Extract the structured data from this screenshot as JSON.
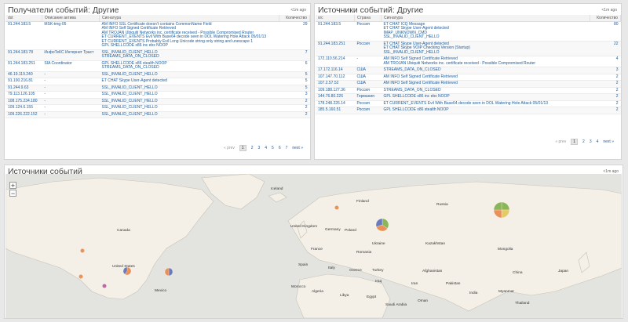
{
  "receivers": {
    "title": "Получатели событий: Другие",
    "ago": "<1m ago",
    "columns": [
      "dst",
      "Описание актива",
      "Сигнатура",
      "Количество"
    ],
    "rows": [
      {
        "dst": "91.244.183.5",
        "asset": "MSK-tmg-05",
        "signatures": [
          "AM INFO SSL Certificate doesn't contains CommonName Field",
          "AM INFO Self Signed Certificate Retrieved",
          "AM TROJAN Ubiquiti Networks inc. certificate received - Possible Compromised Router",
          "ET CURRENT_EVENTS Evil With Base64 decode seen in DOL Watering Hole Attack 05/01/13",
          "ET CURRENT_EVENTS Probably Evil Long Unicode string only string and unescape 1",
          "GPL SHELLCODE x86 inc ebx NOOP"
        ],
        "count": "29"
      },
      {
        "dst": "91.244.183.78",
        "asset": "ИнфоТеКС Интернет Траст",
        "signatures": [
          "SSL_INVALID_CLIENT_HELLO",
          "STREAMS_DATA_ON_CLOSED"
        ],
        "count": "7"
      },
      {
        "dst": "91.244.183.251",
        "asset": "SIA Coordinator",
        "signatures": [
          "GPL SHELLCODE x86 stealth NOOP",
          "STREAMS_DATA_ON_CLOSED"
        ],
        "count": "6"
      },
      {
        "dst": "46.19.119.240",
        "asset": "-",
        "signatures": [
          "SSL_INVALID_CLIENT_HELLO"
        ],
        "count": "5"
      },
      {
        "dst": "91.190.216.81",
        "asset": "-",
        "signatures": [
          "ET CHAT Skype User-Agent detected"
        ],
        "count": "5"
      },
      {
        "dst": "91.244.9.63",
        "asset": "-",
        "signatures": [
          "SSL_INVALID_CLIENT_HELLO"
        ],
        "count": "5"
      },
      {
        "dst": "79.113.126.105",
        "asset": "-",
        "signatures": [
          "SSL_INVALID_CLIENT_HELLO"
        ],
        "count": "3"
      },
      {
        "dst": "108.175.234.180",
        "asset": "-",
        "signatures": [
          "SSL_INVALID_CLIENT_HELLO"
        ],
        "count": "2"
      },
      {
        "dst": "109.124.6.155",
        "asset": "-",
        "signatures": [
          "SSL_INVALID_CLIENT_HELLO"
        ],
        "count": "2"
      },
      {
        "dst": "109.226.222.152",
        "asset": "-",
        "signatures": [
          "SSL_INVALID_CLIENT_HELLO"
        ],
        "count": "2"
      }
    ],
    "pager": {
      "prev": "« prev",
      "pages": [
        "1",
        "2",
        "3",
        "4",
        "5",
        "6",
        "7"
      ],
      "current": "1",
      "next": "next »"
    }
  },
  "sources": {
    "title": "Источники событий: Другие",
    "ago": "<1m ago",
    "columns": [
      "src",
      "Страна",
      "Сигнатура",
      "Количество"
    ],
    "rows": [
      {
        "src": "91.244.183.5",
        "country": "Россия",
        "signatures": [
          "ET CHAT ICQ Message",
          "ET CHAT Skype User-Agent detected",
          "IMAP_UNKNOWN_CMD",
          "SSL_INVALID_CLIENT_HELLO"
        ],
        "count": "80"
      },
      {
        "src": "91.244.183.251",
        "country": "Россия",
        "signatures": [
          "ET CHAT Skype User-Agent detected",
          "ET CHAT Skype VOIP Checking Version (Startup)",
          "SSL_INVALID_CLIENT_HELLO"
        ],
        "count": "22"
      },
      {
        "src": "172.110.56.214",
        "country": "-",
        "signatures": [
          "AM INFO Self Signed Certificate Retrieved",
          "AM TROJAN Ubiquiti Networks inc. certificate received - Possible Compromised Router"
        ],
        "count": "4"
      },
      {
        "src": "17.172.116.14",
        "country": "США",
        "signatures": [
          "STREAMS_DATA_ON_CLOSED"
        ],
        "count": "3"
      },
      {
        "src": "107.147.70.112",
        "country": "США",
        "signatures": [
          "AM INFO Self Signed Certificate Retrieved"
        ],
        "count": "2"
      },
      {
        "src": "107.2.57.52",
        "country": "США",
        "signatures": [
          "AM INFO Self Signed Certificate Retrieved"
        ],
        "count": "2"
      },
      {
        "src": "109.188.127.36",
        "country": "Россия",
        "signatures": [
          "STREAMS_DATA_ON_CLOSED"
        ],
        "count": "2"
      },
      {
        "src": "144.76.80.226",
        "country": "Германия",
        "signatures": [
          "GPL SHELLCODE x86 inc ebx NOOP"
        ],
        "count": "2"
      },
      {
        "src": "178.248.226.14",
        "country": "Россия",
        "signatures": [
          "ET CURRENT_EVENTS Evil With Base64 decode seen in DOL Watering Hole Attack 05/01/13"
        ],
        "count": "2"
      },
      {
        "src": "185.5.160.51",
        "country": "Россия",
        "signatures": [
          "GPL SHELLCODE x86 stealth NOOP"
        ],
        "count": "2"
      }
    ],
    "pager": {
      "prev": "« prev",
      "pages": [
        "1",
        "2",
        "3",
        "4"
      ],
      "current": "1",
      "next": "next »"
    }
  },
  "map": {
    "title": "Источники событий",
    "ago": "<1m ago",
    "zoom_in": "+",
    "zoom_out": "−",
    "labels": [
      {
        "text": "Iceland"
      },
      {
        "text": "Finland"
      },
      {
        "text": "Russia"
      },
      {
        "text": "Canada"
      },
      {
        "text": "United Kingdom"
      },
      {
        "text": "Germany"
      },
      {
        "text": "Poland"
      },
      {
        "text": "Ukraine"
      },
      {
        "text": "Kazakhstan"
      },
      {
        "text": "Mongolia"
      },
      {
        "text": "France"
      },
      {
        "text": "Romania"
      },
      {
        "text": "Italy"
      },
      {
        "text": "Greece"
      },
      {
        "text": "Turkey"
      },
      {
        "text": "Spain"
      },
      {
        "text": "United States"
      },
      {
        "text": "China"
      },
      {
        "text": "Afghanistan"
      },
      {
        "text": "Iraq"
      },
      {
        "text": "Iran"
      },
      {
        "text": "Pakistan"
      },
      {
        "text": "Algeria"
      },
      {
        "text": "Libya"
      },
      {
        "text": "Egypt"
      },
      {
        "text": "India"
      },
      {
        "text": "Mexico"
      },
      {
        "text": "Morocco"
      },
      {
        "text": "Saudi Arabia"
      },
      {
        "text": "Japan"
      },
      {
        "text": "Myanmar"
      },
      {
        "text": "Thailand"
      },
      {
        "text": "Oman"
      }
    ]
  },
  "colors": {
    "accent": "#1a5c9e",
    "pie1": "#e8874a",
    "pie2": "#5a6fb8",
    "pie3": "#7fb04a",
    "pie4": "#e3c85a",
    "pie5": "#b85a9a"
  }
}
